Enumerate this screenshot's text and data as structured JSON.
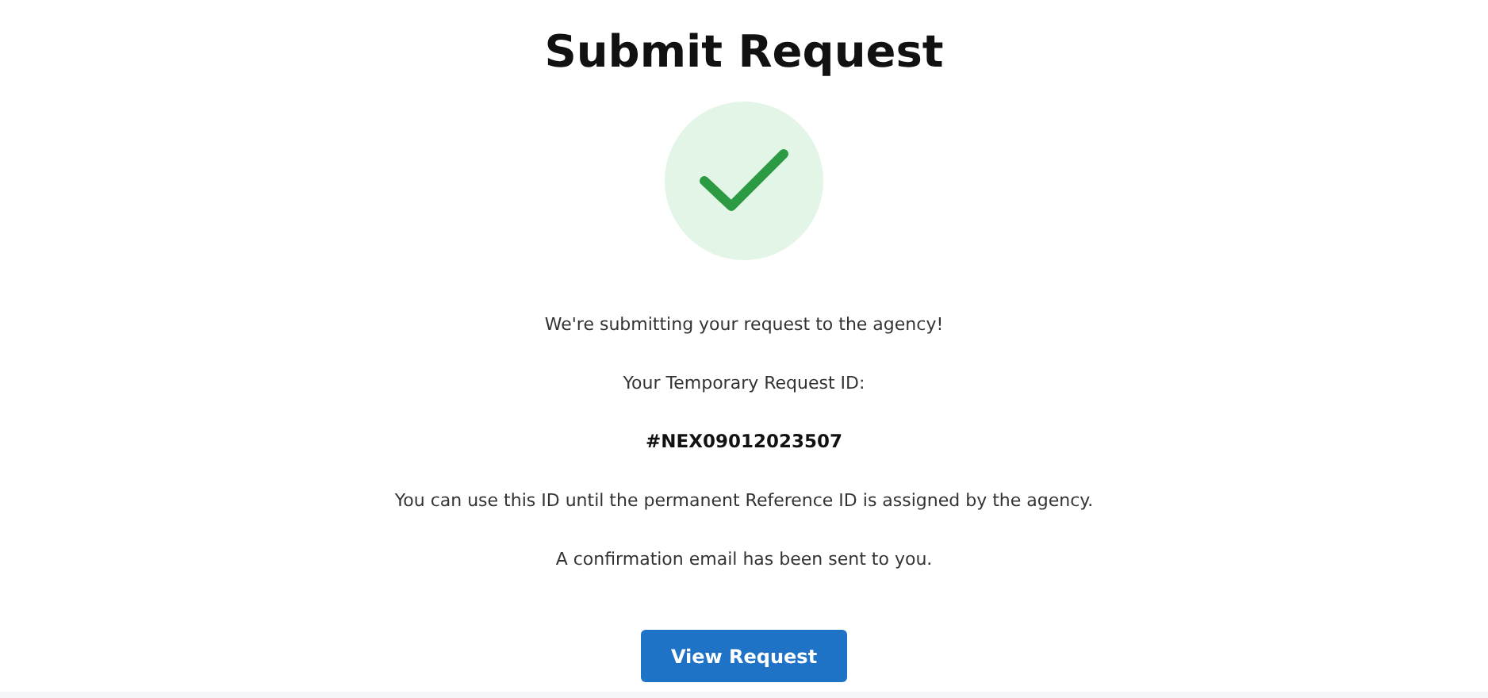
{
  "title": "Submit Request",
  "status": {
    "kind": "success"
  },
  "messages": [
    "We're submitting your request to the agency!",
    "Your Temporary Request ID:"
  ],
  "request_id": "#NEX09012023507",
  "notes": [
    "You can use this ID until the permanent Reference ID is assigned by the agency.",
    "A confirmation email has been sent to you."
  ],
  "button": {
    "label": "View Request"
  }
}
